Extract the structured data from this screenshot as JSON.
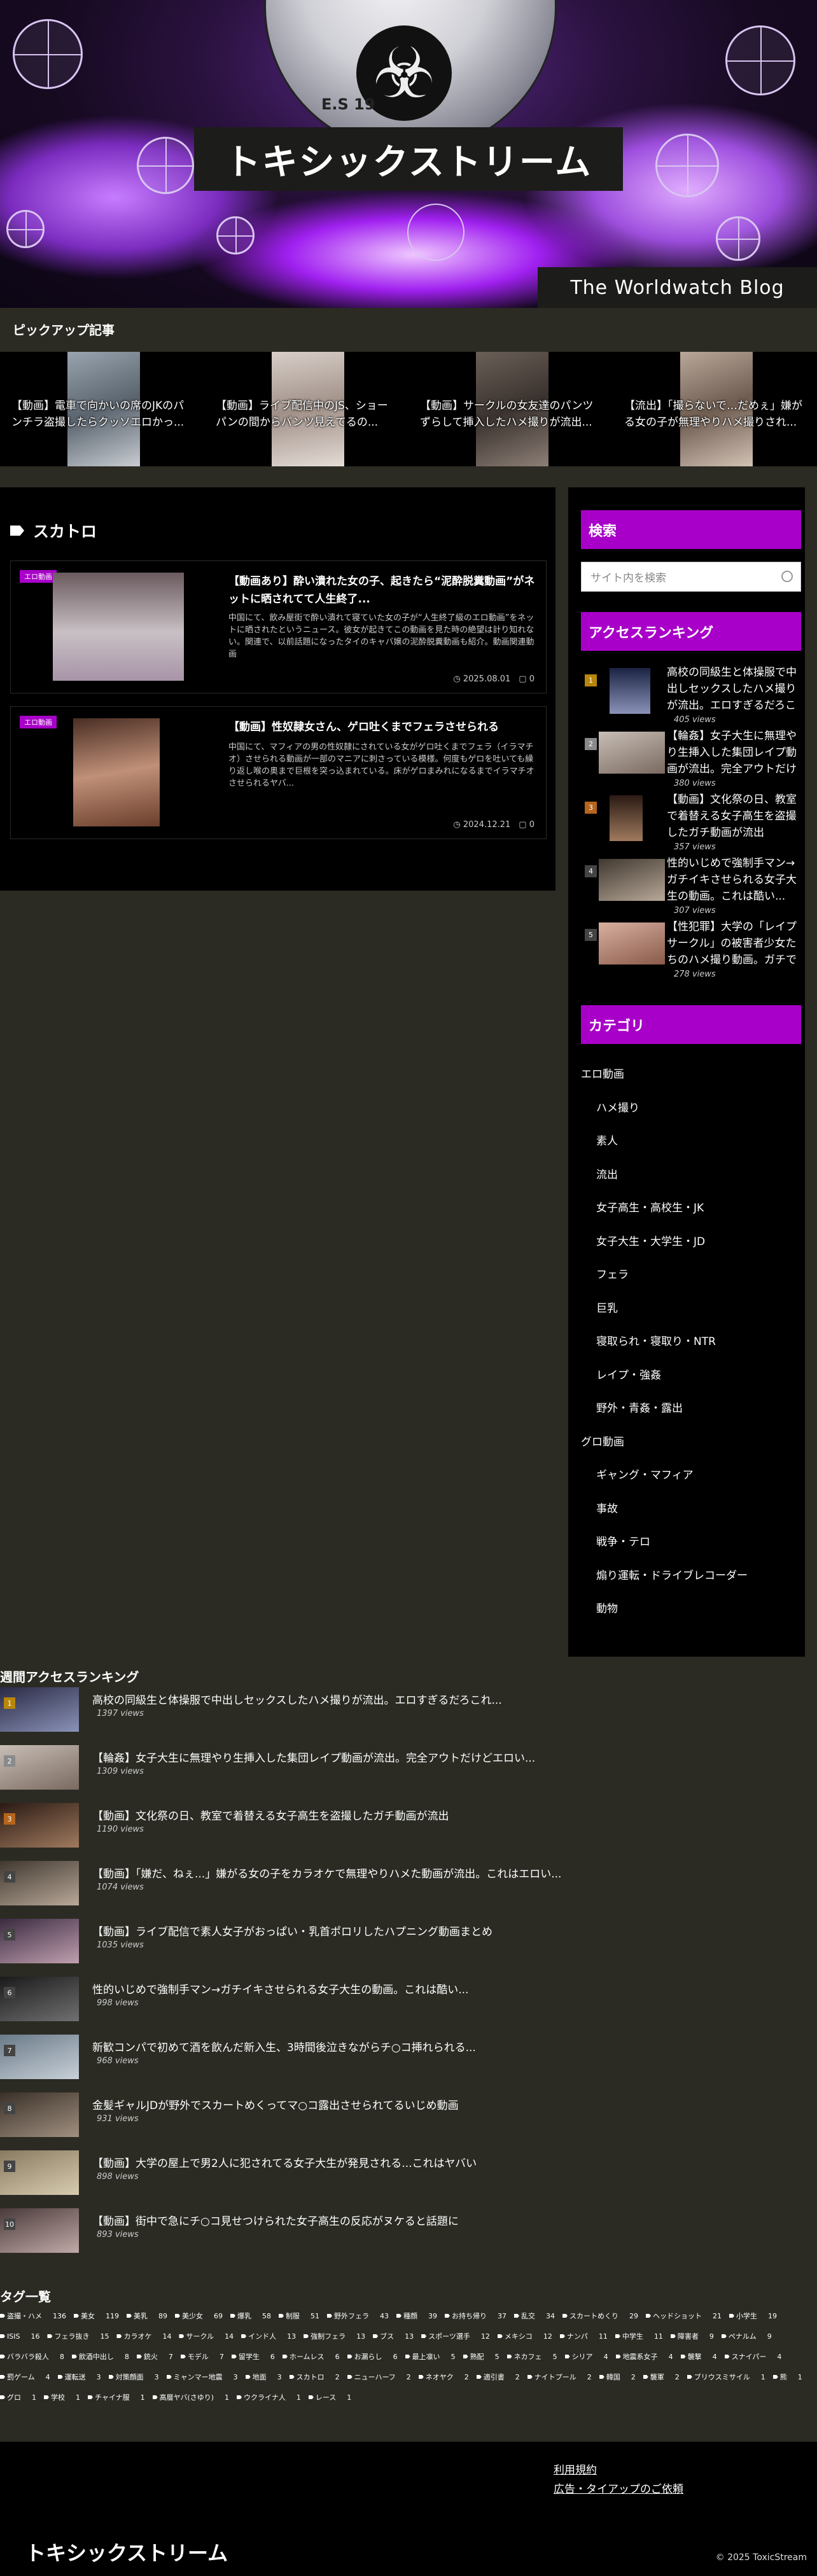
{
  "site": {
    "title": "トキシックストリーム",
    "tagline": "The Worldwatch Blog",
    "logo_text": "E.S 19"
  },
  "pickup": {
    "heading": "ピックアップ記事",
    "items": [
      {
        "title": "【動画】電車で向かいの席のJKのパンチラ盗撮したらクッソエロかっ..."
      },
      {
        "title": "【動画】ライブ配信中のJS、ショーパンの間からパンツ見えてるの..."
      },
      {
        "title": "【動画】サークルの女友達のパンツずらして挿入したハメ撮りが流出..."
      },
      {
        "title": "【流出】「撮らないで…だめぇ」嫌がる女の子が無理やりハメ撮りされ..."
      }
    ]
  },
  "category": {
    "heading": "スカトロ",
    "posts": [
      {
        "badge": "エロ動画",
        "title": "【動画あり】酔い潰れた女の子、起きたら“泥酔脱糞動画”がネットに晒されてて人生終了...",
        "excerpt": "中国にて、飲み屋街で酔い潰れて寝ていた女の子が“人生終了級のエロ動画”をネットに晒されたというニュース。彼女が起きてこの動画を見た時の絶望は計り知れない。関連で、以前話題になったタイのキャバ嬢の泥酔脱糞動画も紹介。動画関連動画",
        "date": "2025.08.01",
        "comments": "0"
      },
      {
        "badge": "エロ動画",
        "title": "【動画】性奴隷女さん、ゲロ吐くまでフェラさせられる",
        "excerpt": "中国にて、マフィアの男の性奴隷にされている女がゲロ吐くまでフェラ（イラマチオ）させられる動画が一部のマニアに刺さっている模様。何度もゲロを吐いても繰り返し喉の奥まで巨根を突っ込まれている。床がゲロまみれになるまでイラマチオさせられるヤバ...",
        "date": "2024.12.21",
        "comments": "0"
      }
    ]
  },
  "sidebar": {
    "search_heading": "検索",
    "search_placeholder": "サイト内を検索",
    "ranking_heading": "アクセスランキング",
    "ranking": [
      {
        "rank": "1",
        "title": "高校の同級生と体操服で中出しセックスしたハメ撮りが流出。エロすぎるだろこれ...",
        "views": "405 views"
      },
      {
        "rank": "2",
        "title": "【輪姦】女子大生に無理やり生挿入した集団レイプ動画が流出。完全アウトだけどエロい...",
        "views": "380 views"
      },
      {
        "rank": "3",
        "title": "【動画】文化祭の日、教室で着替える女子高生を盗撮したガチ動画が流出",
        "views": "357 views"
      },
      {
        "rank": "4",
        "title": "性的いじめで強制手マン→ガチイキさせられる女子大生の動画。これは酷い...",
        "views": "307 views"
      },
      {
        "rank": "5",
        "title": "【性犯罪】大学の「レイプサークル」の被害者少女たちのハメ撮り動画。ガチでヤバい",
        "views": "278 views"
      }
    ],
    "category_heading": "カテゴリ",
    "categories": [
      {
        "label": "エロ動画",
        "indent": false
      },
      {
        "label": "ハメ撮り",
        "indent": true
      },
      {
        "label": "素人",
        "indent": true
      },
      {
        "label": "流出",
        "indent": true
      },
      {
        "label": "女子高生・高校生・JK",
        "indent": true
      },
      {
        "label": "女子大生・大学生・JD",
        "indent": true
      },
      {
        "label": "フェラ",
        "indent": true
      },
      {
        "label": "巨乳",
        "indent": true
      },
      {
        "label": "寝取られ・寝取り・NTR",
        "indent": true
      },
      {
        "label": "レイプ・強姦",
        "indent": true
      },
      {
        "label": "野外・青姦・露出",
        "indent": true
      },
      {
        "label": "グロ動画",
        "indent": false
      },
      {
        "label": "ギャング・マフィア",
        "indent": true
      },
      {
        "label": "事故",
        "indent": true
      },
      {
        "label": "戦争・テロ",
        "indent": true
      },
      {
        "label": "煽り運転・ドライブレコーダー",
        "indent": true
      },
      {
        "label": "動物",
        "indent": true
      }
    ]
  },
  "weekly": {
    "heading": "週間アクセスランキング",
    "items": [
      {
        "rank": "1",
        "title": "高校の同級生と体操服で中出しセックスしたハメ撮りが流出。エロすぎるだろこれ...",
        "views": "1397 views"
      },
      {
        "rank": "2",
        "title": "【輪姦】女子大生に無理やり生挿入した集団レイプ動画が流出。完全アウトだけどエロい...",
        "views": "1309 views"
      },
      {
        "rank": "3",
        "title": "【動画】文化祭の日、教室で着替える女子高生を盗撮したガチ動画が流出",
        "views": "1190 views"
      },
      {
        "rank": "4",
        "title": "【動画】「嫌だ、ねぇ...」嫌がる女の子をカラオケで無理やりハメた動画が流出。これはエロい...",
        "views": "1074 views"
      },
      {
        "rank": "5",
        "title": "【動画】ライブ配信で素人女子がおっぱい・乳首ポロリしたハプニング動画まとめ",
        "views": "1035 views"
      },
      {
        "rank": "6",
        "title": "性的いじめで強制手マン→ガチイキさせられる女子大生の動画。これは酷い...",
        "views": "998 views"
      },
      {
        "rank": "7",
        "title": "新歓コンパで初めて酒を飲んだ新入生、3時間後泣きながらチ○コ挿れられる...",
        "views": "968 views"
      },
      {
        "rank": "8",
        "title": "金髪ギャルJDが野外でスカートめくってマ○コ露出させられてるいじめ動画",
        "views": "931 views"
      },
      {
        "rank": "9",
        "title": "【動画】大学の屋上で男2人に犯されてる女子大生が発見される...これはヤバい",
        "views": "898 views"
      },
      {
        "rank": "10",
        "title": "【動画】街中で急にチ○コ見せつけられた女子高生の反応がヌケると話題に",
        "views": "893 views"
      }
    ]
  },
  "tags": {
    "heading": "タグ一覧",
    "items": [
      {
        "name": "盗撮・ハメ",
        "count": "136"
      },
      {
        "name": "美女",
        "count": "119"
      },
      {
        "name": "美乳",
        "count": "89"
      },
      {
        "name": "美少女",
        "count": "69"
      },
      {
        "name": "爆乳",
        "count": "58"
      },
      {
        "name": "制服",
        "count": "51"
      },
      {
        "name": "野外フェラ",
        "count": "43"
      },
      {
        "name": "種顔",
        "count": "39"
      },
      {
        "name": "お持ち帰り",
        "count": "37"
      },
      {
        "name": "乱交",
        "count": "34"
      },
      {
        "name": "スカートめくり",
        "count": "29"
      },
      {
        "name": "ヘッドショット",
        "count": "21"
      },
      {
        "name": "小学生",
        "count": "19"
      },
      {
        "name": "ISIS",
        "count": "16"
      },
      {
        "name": "フェラ抜き",
        "count": "15"
      },
      {
        "name": "カラオケ",
        "count": "14"
      },
      {
        "name": "サークル",
        "count": "14"
      },
      {
        "name": "インド人",
        "count": "13"
      },
      {
        "name": "強制フェラ",
        "count": "13"
      },
      {
        "name": "ブス",
        "count": "13"
      },
      {
        "name": "スポーツ選手",
        "count": "12"
      },
      {
        "name": "メキシコ",
        "count": "12"
      },
      {
        "name": "ナンパ",
        "count": "11"
      },
      {
        "name": "中学生",
        "count": "11"
      },
      {
        "name": "障害者",
        "count": "9"
      },
      {
        "name": "ペナルム",
        "count": "9"
      },
      {
        "name": "バラバラ殺人",
        "count": "8"
      },
      {
        "name": "飲酒中出し",
        "count": "8"
      },
      {
        "name": "銃火",
        "count": "7"
      },
      {
        "name": "モデル",
        "count": "7"
      },
      {
        "name": "留学生",
        "count": "6"
      },
      {
        "name": "ホームレス",
        "count": "6"
      },
      {
        "name": "お漏らし",
        "count": "6"
      },
      {
        "name": "最上凛い",
        "count": "5"
      },
      {
        "name": "熟配",
        "count": "5"
      },
      {
        "name": "ネカフェ",
        "count": "5"
      },
      {
        "name": "シリア",
        "count": "4"
      },
      {
        "name": "地震系女子",
        "count": "4"
      },
      {
        "name": "襲撃",
        "count": "4"
      },
      {
        "name": "スナイパー",
        "count": "4"
      },
      {
        "name": "罰ゲーム",
        "count": "4"
      },
      {
        "name": "運転送",
        "count": "3"
      },
      {
        "name": "対策顔面",
        "count": "3"
      },
      {
        "name": "ミャンマー地震",
        "count": "3"
      },
      {
        "name": "地面",
        "count": "3"
      },
      {
        "name": "スカトロ",
        "count": "2"
      },
      {
        "name": "ニューハーフ",
        "count": "2"
      },
      {
        "name": "ネオヤク",
        "count": "2"
      },
      {
        "name": "適引書",
        "count": "2"
      },
      {
        "name": "ナイトプール",
        "count": "2"
      },
      {
        "name": "韓国",
        "count": "2"
      },
      {
        "name": "襲軍",
        "count": "2"
      },
      {
        "name": "ブリウスミサイル",
        "count": "1"
      },
      {
        "name": "熊",
        "count": "1"
      },
      {
        "name": "グロ",
        "count": "1"
      },
      {
        "name": "学校",
        "count": "1"
      },
      {
        "name": "チャイナ服",
        "count": "1"
      },
      {
        "name": "高層ヤバ(さゆり)",
        "count": "1"
      },
      {
        "name": "ウクライナ人",
        "count": "1"
      },
      {
        "name": "レース",
        "count": "1"
      }
    ]
  },
  "footer": {
    "links": [
      "利用規約",
      "広告・タイアップのご依頼"
    ],
    "title": "トキシックストリーム",
    "copyright": "© 2025 ToxicStream"
  },
  "colors": {
    "accent": "#a800c8",
    "background": "#2b2b24",
    "panel": "#000000",
    "rank1": "#b8860b",
    "rank2": "#8a8a8a",
    "rank3": "#b5651d"
  }
}
